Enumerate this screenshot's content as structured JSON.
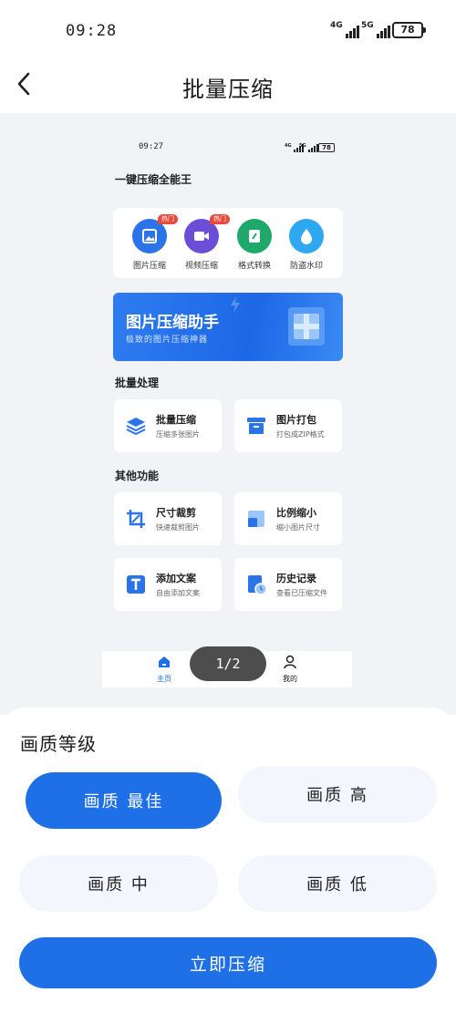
{
  "status_bar": {
    "time": "09:28",
    "network_1": "4G",
    "network_2": "5G",
    "battery": "78"
  },
  "header": {
    "title": "批量压缩",
    "back_icon": "chevron-left-icon"
  },
  "preview": {
    "status_time": "09:27",
    "status_network_1": "4G",
    "status_network_2": "5G",
    "status_battery": "78",
    "section_quick": "一键压缩全能王",
    "quick_items": [
      {
        "label": "图片压缩",
        "badge": "热门",
        "icon": "image-icon",
        "color": "#2a73e8"
      },
      {
        "label": "视频压缩",
        "badge": "热门",
        "icon": "video-icon",
        "color": "#6a4fd6"
      },
      {
        "label": "格式转换",
        "badge": "",
        "icon": "edit-icon",
        "color": "#1fa86b"
      },
      {
        "label": "防盗水印",
        "badge": "",
        "icon": "drop-icon",
        "color": "#2ea8f0"
      }
    ],
    "banner": {
      "title": "图片压缩助手",
      "subtitle": "极致的图片压缩神器"
    },
    "section_batch": "批量处理",
    "batch_tools": [
      {
        "name": "批量压缩",
        "desc": "压缩多张图片",
        "icon": "layers-icon"
      },
      {
        "name": "图片打包",
        "desc": "打包成ZIP格式",
        "icon": "archive-icon"
      }
    ],
    "section_other": "其他功能",
    "other_tools": [
      {
        "name": "尺寸裁剪",
        "desc": "快速裁剪图片",
        "icon": "crop-icon"
      },
      {
        "name": "比例缩小",
        "desc": "缩小图片尺寸",
        "icon": "resize-icon"
      },
      {
        "name": "添加文案",
        "desc": "自由添加文案",
        "icon": "text-icon"
      },
      {
        "name": "历史记录",
        "desc": "查看已压缩文件",
        "icon": "history-icon"
      }
    ],
    "tabs": [
      {
        "label": "主页",
        "icon": "home-icon"
      },
      {
        "label": "我的",
        "icon": "user-icon"
      }
    ],
    "page_indicator": "1/2"
  },
  "quality": {
    "title": "画质等级",
    "options": [
      "画质 最佳",
      "画质 高",
      "画质 中",
      "画质 低"
    ],
    "selected": "画质 最佳"
  },
  "action": {
    "compress_label": "立即压缩"
  },
  "colors": {
    "accent": "#1f70e6",
    "option_bg": "#f3f6fc",
    "preview_bg": "#f1f3f7"
  }
}
